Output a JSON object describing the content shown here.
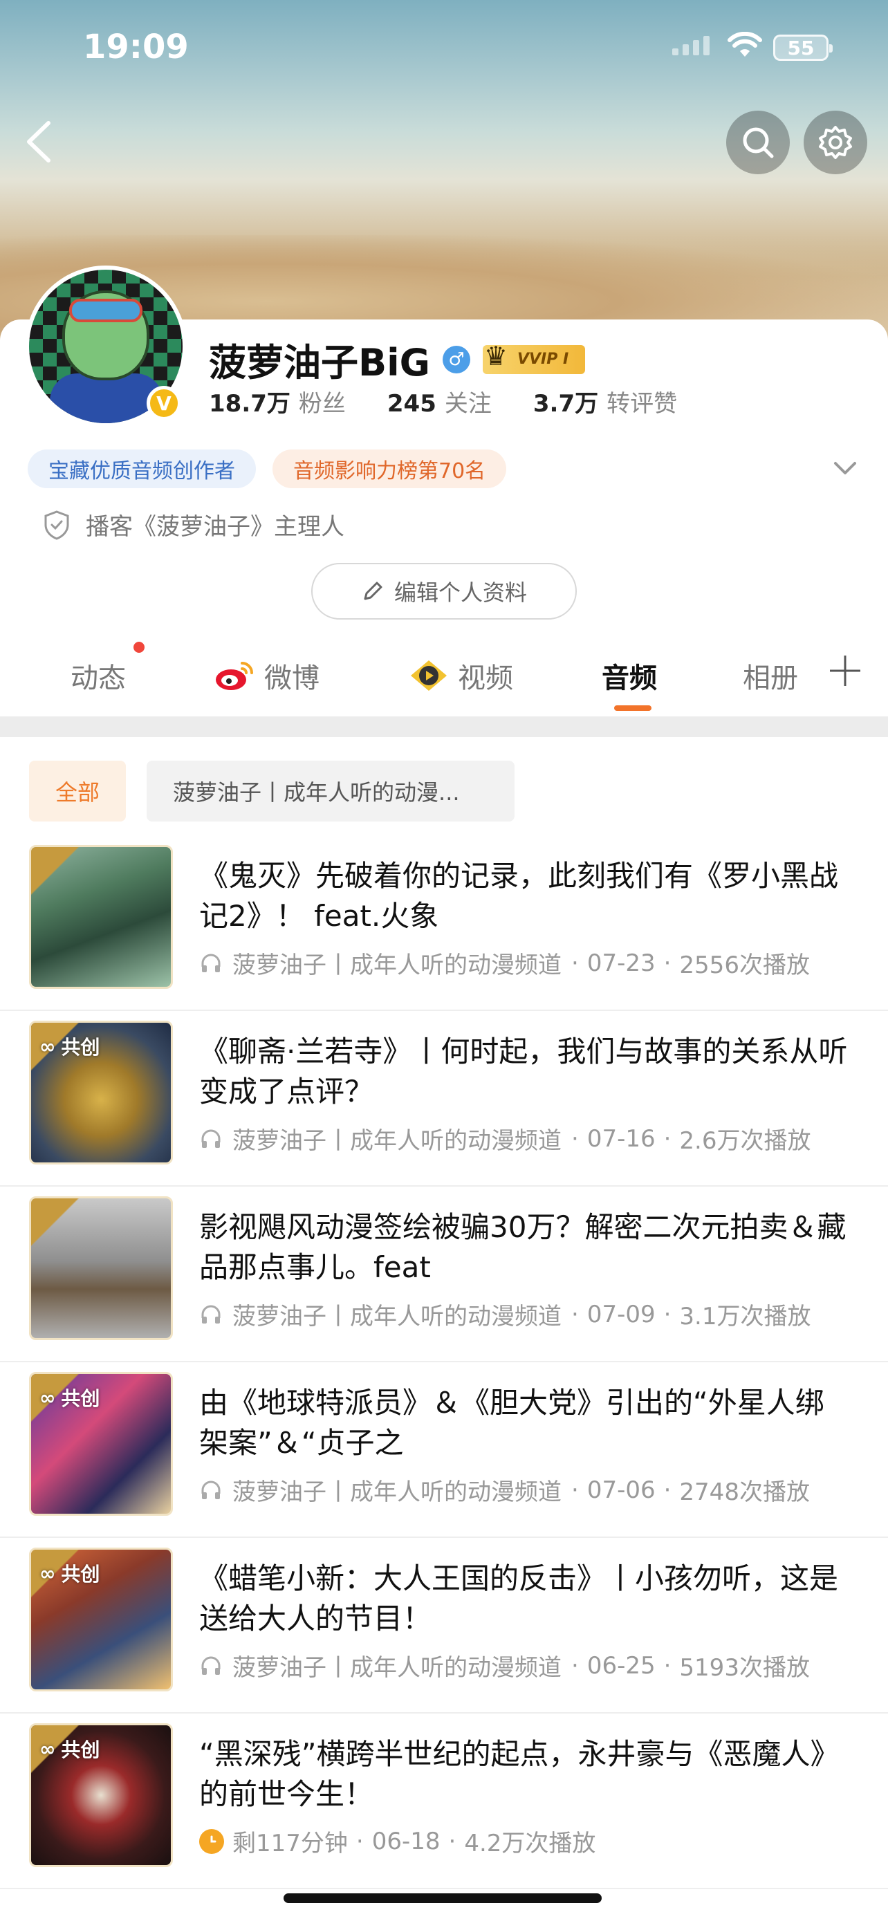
{
  "status_bar": {
    "time": "19:09",
    "battery": "55"
  },
  "header": {
    "back": "back-icon",
    "search": "search-icon",
    "settings": "gear-icon"
  },
  "profile": {
    "name": "菠萝油子BiG",
    "vip_label": "VVIP I",
    "stats": [
      {
        "value": "18.7万",
        "label": "粉丝"
      },
      {
        "value": "245",
        "label": "关注"
      },
      {
        "value": "3.7万",
        "label": "转评赞"
      }
    ],
    "tags": [
      "宝藏优质音频创作者",
      "音频影响力榜第70名"
    ],
    "podcast_line": "播客《菠萝油子》主理人",
    "edit_button": "编辑个人资料",
    "verified_badge": "V"
  },
  "tabs": [
    {
      "label": "动态"
    },
    {
      "label": "微博"
    },
    {
      "label": "视频"
    },
    {
      "label": "音频"
    },
    {
      "label": "相册"
    }
  ],
  "filters": [
    "全部",
    "菠萝油子丨成年人听的动漫..."
  ],
  "co_create_label": "共创",
  "items": [
    {
      "title": "《鬼灭》先破着你的记录，此刻我们有《罗小黑战记2》！ feat.火象",
      "source": "菠萝油子丨成年人听的动漫频道",
      "date": "07-23",
      "plays": "2556次播放"
    },
    {
      "title": "《聊斋·兰若寺》丨何时起，我们与故事的关系从听变成了点评？",
      "source": "菠萝油子丨成年人听的动漫频道",
      "date": "07-16",
      "plays": "2.6万次播放"
    },
    {
      "title": "影视飓风动漫签绘被骗30万？解密二次元拍卖＆藏品那点事儿。feat",
      "source": "菠萝油子丨成年人听的动漫频道",
      "date": "07-09",
      "plays": "3.1万次播放"
    },
    {
      "title": "由《地球特派员》＆《胆大党》引出的“外星人绑架案”＆“贞子之",
      "source": "菠萝油子丨成年人听的动漫频道",
      "date": "07-06",
      "plays": "2748次播放"
    },
    {
      "title": "《蜡笔小新：大人王国的反击》丨小孩勿听，这是送给大人的节目！",
      "source": "菠萝油子丨成年人听的动漫频道",
      "date": "06-25",
      "plays": "5193次播放"
    },
    {
      "title": "“黑深残”横跨半世纪的起点，永井豪与《恶魔人》的前世今生！",
      "remaining": "剩117分钟",
      "date": "06-18",
      "plays": "4.2万次播放"
    }
  ]
}
